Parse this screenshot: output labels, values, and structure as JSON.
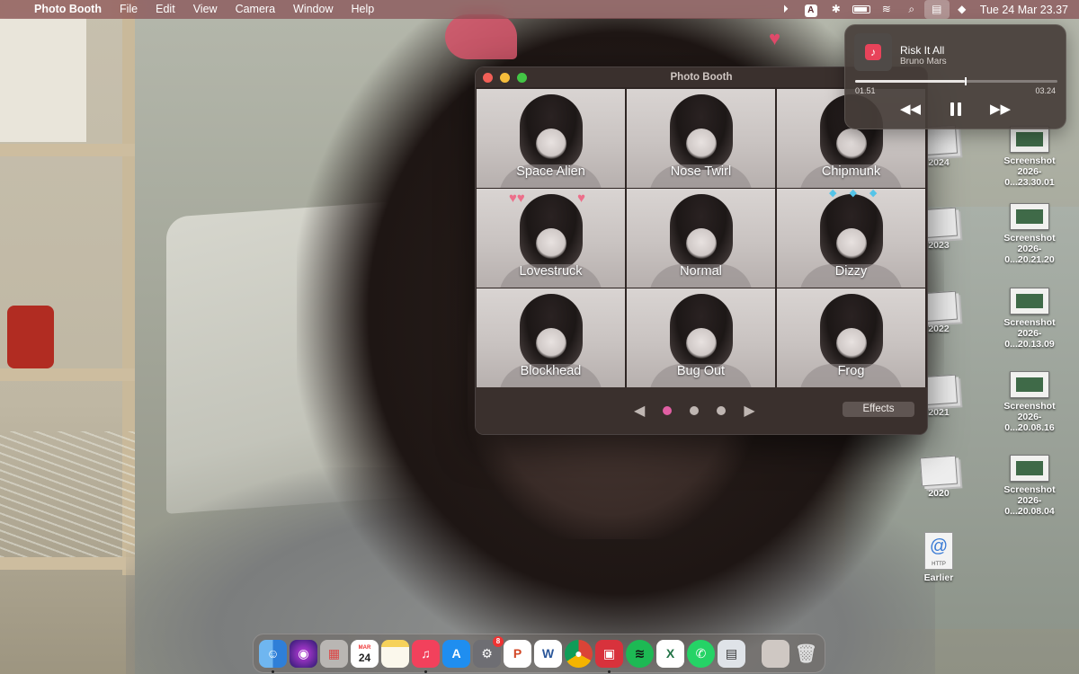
{
  "menubar": {
    "app_name": "Photo Booth",
    "menus": [
      "File",
      "Edit",
      "View",
      "Camera",
      "Window",
      "Help"
    ],
    "clock": "Tue 24 Mar  23.37",
    "accessibility_letter": "A"
  },
  "now_playing": {
    "title": "Risk It All",
    "artist": "Bruno Mars",
    "elapsed": "01.51",
    "duration": "03.24",
    "progress_fraction": 0.544
  },
  "photo_booth": {
    "window_title": "Photo Booth",
    "effects": [
      {
        "label": "Space Alien"
      },
      {
        "label": "Nose Twirl"
      },
      {
        "label": "Chipmunk"
      },
      {
        "label": "Lovestruck"
      },
      {
        "label": "Normal"
      },
      {
        "label": "Dizzy"
      },
      {
        "label": "Blockhead"
      },
      {
        "label": "Bug Out"
      },
      {
        "label": "Frog"
      }
    ],
    "page_count": 3,
    "current_page": 1,
    "effects_button": "Effects"
  },
  "desktop": {
    "items": [
      {
        "label": "2024"
      },
      {
        "label": "Screenshot",
        "sublabel": "2026-0...23.30.01"
      },
      {
        "label": "2023"
      },
      {
        "label": "Screenshot",
        "sublabel": "2026-0...20.21.20"
      },
      {
        "label": "2022"
      },
      {
        "label": "Screenshot",
        "sublabel": "2026-0...20.13.09"
      },
      {
        "label": "2021"
      },
      {
        "label": "Screenshot",
        "sublabel": "2026-0...20.08.16"
      },
      {
        "label": "2020"
      },
      {
        "label": "Screenshot",
        "sublabel": "2026-0...20.08.04"
      },
      {
        "label": "Earlier"
      }
    ],
    "http_doc_text": "HTTP"
  },
  "dock": {
    "calendar_month": "MAR",
    "calendar_day": "24",
    "system_settings_badge": "8",
    "apps": [
      "finder",
      "siri",
      "launchpad",
      "calendar",
      "notes",
      "music",
      "app-store",
      "system-settings",
      "powerpoint",
      "word",
      "chrome",
      "photo-booth",
      "spotify",
      "excel",
      "whatsapp",
      "preview",
      "photos-stack",
      "trash"
    ]
  },
  "colors": {
    "accent_pink": "#e15fa3",
    "menubar_tint": "#782d37",
    "music_red": "#e8435a"
  }
}
